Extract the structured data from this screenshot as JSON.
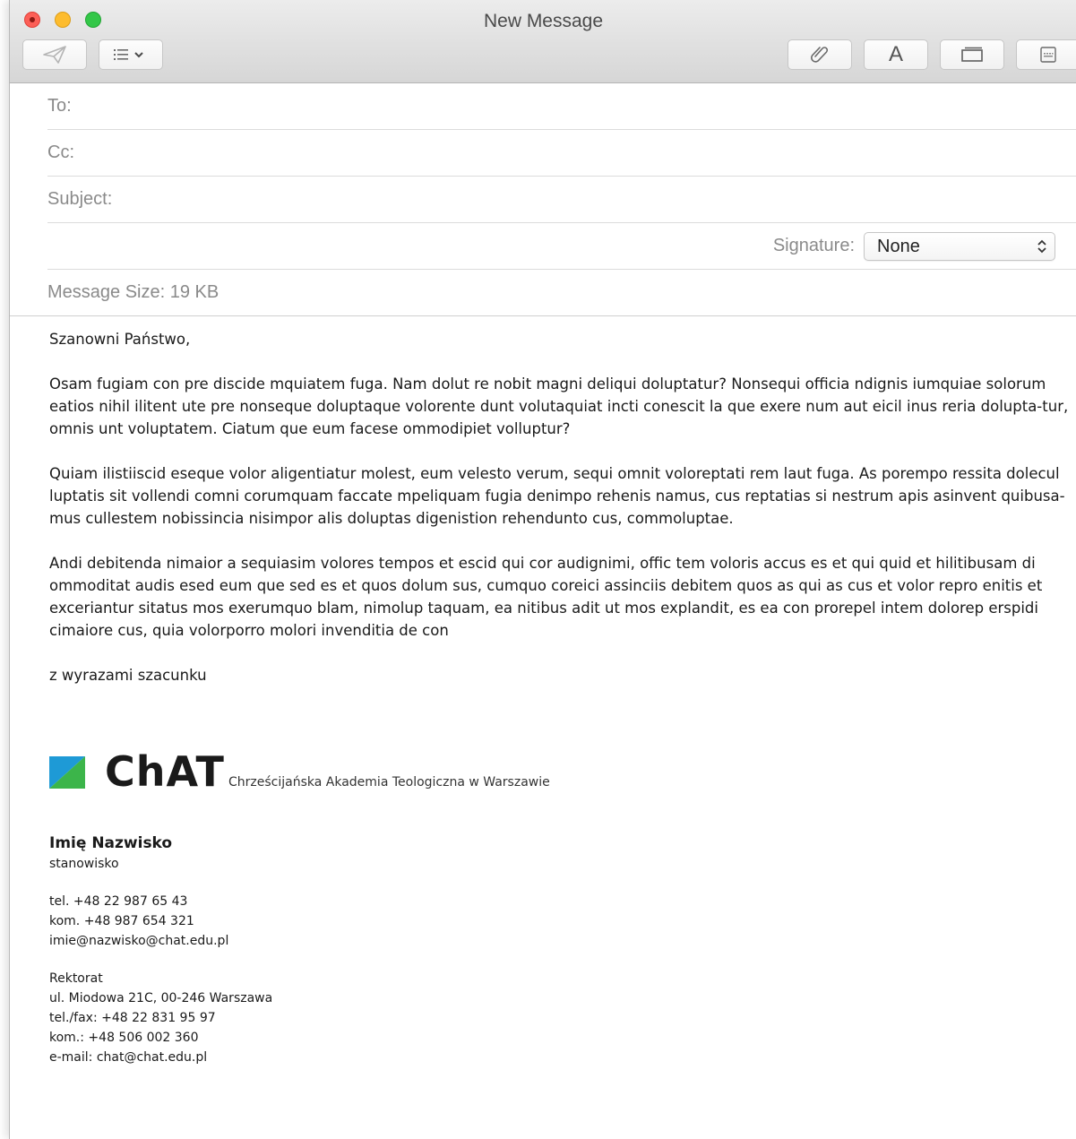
{
  "window": {
    "title": "New Message"
  },
  "toolbar": {
    "send_icon": "paper-plane-icon",
    "list_icon": "list-icon",
    "attach_icon": "paperclip-icon",
    "font_label": "A",
    "photo_icon": "photo-browser-icon",
    "format_icon": "format-bar-icon"
  },
  "headers": {
    "to_label": "To:",
    "cc_label": "Cc:",
    "subject_label": "Subject:",
    "signature_label": "Signature:",
    "signature_value": "None",
    "message_size": "Message Size: 19 KB"
  },
  "body": {
    "greeting": "Szanowni Państwo,",
    "p1": "Osam fugiam con pre discide mquiatem fuga. Nam dolut re nobit magni deliqui doluptatur? Nonsequi officia ndignis iumquiae solorum eatios nihil ilitent ute pre nonseque doluptaque volorente dunt volutaquiat incti conescit la que exere num aut eicil inus reria dolupta-tur, omnis unt voluptatem. Ciatum que eum facese ommodipiet volluptur?",
    "p2": "Quiam ilistiiscid eseque volor aligentiatur molest, eum velesto verum, sequi omnit voloreptati rem laut fuga. As porempo ressita dolecul luptatis sit vollendi comni corumquam faccate mpeliquam fugia denimpo rehenis namus, cus reptatias si nestrum apis asinvent quibusa-mus cullestem nobissincia nisimpor alis doluptas digenistion rehendunto cus, commoluptae.",
    "p3": "Andi debitenda nimaior a sequiasim volores tempos et escid qui cor audignimi, offic tem voloris accus es et qui quid et hilitibusam di ommoditat audis esed eum que sed es et quos dolum sus, cumquo coreici assinciis debitem quos as qui as cus et volor repro enitis et exceriantur sitatus mos exerumquo blam, nimolup taquam, ea nitibus adit ut mos explandit, es ea con prorepel intem dolorep erspidi cimaiore cus, quia volorporro molori invenditia de con",
    "closing": "z wyrazami szacunku"
  },
  "logo": {
    "wordmark": "ChAT",
    "subtitle": "Chrześcijańska Akademia Teologiczna w Warszawie",
    "colors": {
      "blue": "#1e9ad6",
      "green": "#3cb54a"
    }
  },
  "signature": {
    "name": "Imię Nazwisko",
    "position": "stanowisko",
    "tel": "tel. +48 22 987 65 43",
    "kom": "kom. +48 987 654 321",
    "email": "imie@nazwisko@chat.edu.pl",
    "office": "Rektorat",
    "address": "ul. Miodowa 21C, 00-246 Warszawa",
    "telfax": "tel./fax: +48 22 831 95 97",
    "office_kom": "kom.: +48 506 002 360",
    "office_email": "e-mail: chat@chat.edu.pl"
  }
}
